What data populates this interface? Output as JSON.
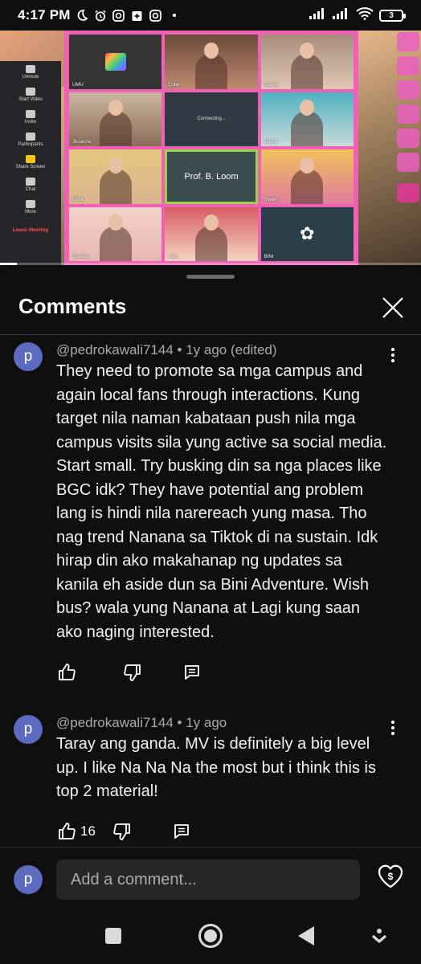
{
  "status_bar": {
    "time": "4:17 PM",
    "left_icons": [
      "moon-icon",
      "alarm-icon",
      "instagram-icon",
      "medical-app-icon",
      "instagram-icon"
    ],
    "right_icons": [
      "signal-icon",
      "signal-icon",
      "wifi-icon"
    ],
    "battery": "3"
  },
  "video": {
    "zoom_sidebar": [
      "Unmute",
      "Start Video",
      "Invite",
      "Participants",
      "Share Screen",
      "Chat",
      "More",
      "Leave Meeting"
    ],
    "tiles": [
      {
        "name": "UMU",
        "center": ""
      },
      {
        "name": "Colet",
        "center": ""
      },
      {
        "name": "Stacey",
        "center": ""
      },
      {
        "name": "Jhoanna",
        "center": ""
      },
      {
        "name": "",
        "center": "Connecting..."
      },
      {
        "name": "Mikha",
        "center": ""
      },
      {
        "name": "Maloi",
        "center": ""
      },
      {
        "name": "",
        "center": "Prof. B. Loom"
      },
      {
        "name": "Gwen",
        "center": ""
      },
      {
        "name": "Sheena",
        "center": ""
      },
      {
        "name": "Aiah",
        "center": ""
      },
      {
        "name": "BINI",
        "center": ""
      }
    ],
    "progress": 0.04
  },
  "sheet": {
    "title": "Comments"
  },
  "comments": [
    {
      "avatar": "p",
      "meta": "@pedrokawali7144 • 1y ago (edited)",
      "text": "They need to promote sa mga campus and again local fans through interactions. Kung target nila naman kabataan push nila mga campus visits sila yung active sa social media. Start small. Try busking din sa nga places like BGC idk? They have potential ang problem lang is hindi nila narereach yung masa. Tho nag trend Nanana sa Tiktok di na sustain. Idk hirap din ako makahanap ng updates sa kanila eh aside dun sa Bini Adventure. Wish bus? wala yung Nanana at Lagi kung saan ako naging interested.",
      "likes": ""
    },
    {
      "avatar": "p",
      "meta": "@pedrokawali7144 • 1y ago",
      "text": "Taray ang ganda. MV is definitely a big level up. I like Na Na Na the most but i think this is top 2 material!",
      "likes": "16"
    }
  ],
  "composer": {
    "avatar": "p",
    "placeholder": "Add a comment..."
  }
}
